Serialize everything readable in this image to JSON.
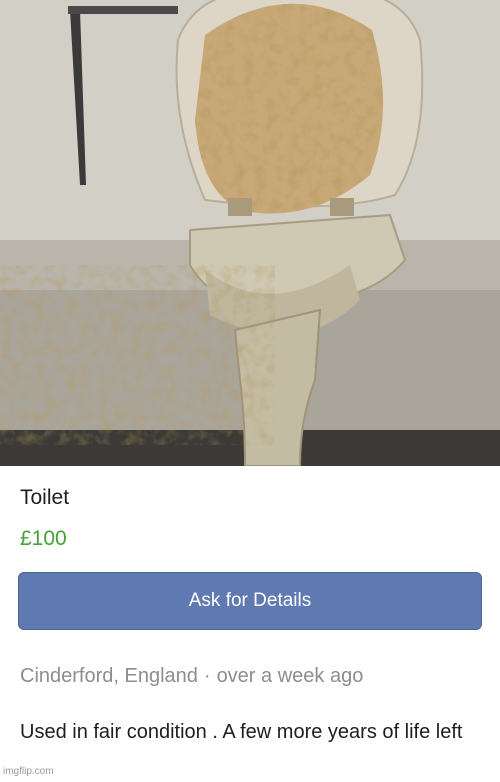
{
  "listing": {
    "title": "Toilet",
    "price": "£100",
    "ask_button_label": "Ask for Details",
    "location": "Cinderford, England",
    "separator": "·",
    "posted": "over a week ago",
    "description": "Used in fair condition . A few more years of life left"
  },
  "watermark": "imgflip.com",
  "colors": {
    "price": "#42a335",
    "button": "#5f7ab3",
    "meta": "#8a8d91"
  }
}
